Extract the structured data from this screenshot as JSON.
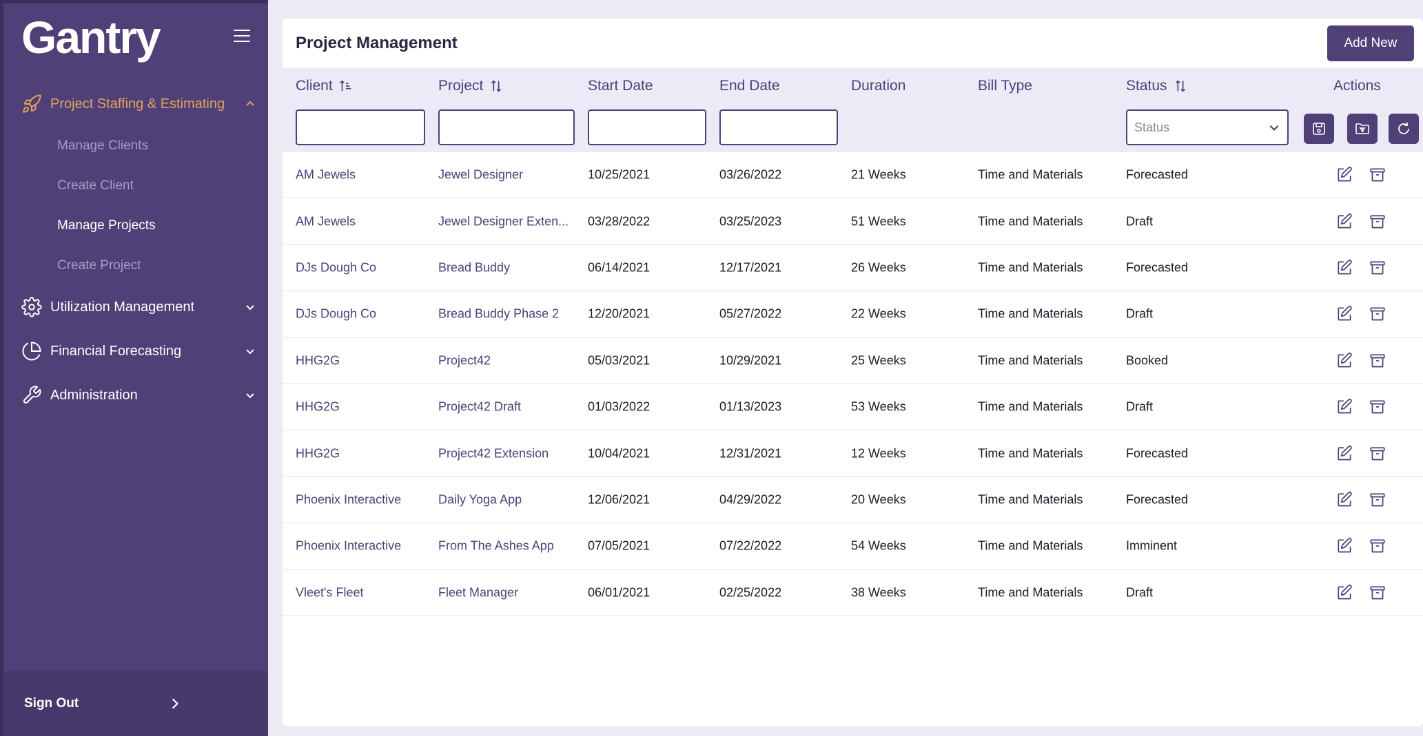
{
  "brand": {
    "logo_text": "Gantry"
  },
  "sidebar": {
    "groups": [
      {
        "label": "Project Staffing & Estimating",
        "icon": "rocket-icon",
        "expanded": true
      },
      {
        "label": "Utilization Management",
        "icon": "gear-icon",
        "expanded": false
      },
      {
        "label": "Financial Forecasting",
        "icon": "pie-chart-icon",
        "expanded": false
      },
      {
        "label": "Administration",
        "icon": "wrench-icon",
        "expanded": false
      }
    ],
    "sub_items": [
      {
        "label": "Manage Clients"
      },
      {
        "label": "Create Client"
      },
      {
        "label": "Manage Projects",
        "current": true
      },
      {
        "label": "Create Project"
      }
    ],
    "sign_out": "Sign Out"
  },
  "colors": {
    "brand": "#4f4078",
    "accent": "#e4a25c",
    "header_bg": "#ebeaf6"
  },
  "page": {
    "title": "Project Management",
    "add_button": "Add New",
    "columns": {
      "client": "Client",
      "project": "Project",
      "start_date": "Start Date",
      "end_date": "End Date",
      "duration": "Duration",
      "bill_type": "Bill Type",
      "status": "Status",
      "actions": "Actions"
    },
    "filters": {
      "client": "",
      "project": "",
      "start_date": "",
      "end_date": "",
      "status_placeholder": "Status"
    },
    "rows": [
      {
        "client": "AM Jewels",
        "project": "Jewel Designer",
        "start": "10/25/2021",
        "end": "03/26/2022",
        "duration": "21 Weeks",
        "bill": "Time and Materials",
        "status": "Forecasted"
      },
      {
        "client": "AM Jewels",
        "project": "Jewel Designer Exten...",
        "start": "03/28/2022",
        "end": "03/25/2023",
        "duration": "51 Weeks",
        "bill": "Time and Materials",
        "status": "Draft"
      },
      {
        "client": "DJs Dough Co",
        "project": "Bread Buddy",
        "start": "06/14/2021",
        "end": "12/17/2021",
        "duration": "26 Weeks",
        "bill": "Time and Materials",
        "status": "Forecasted"
      },
      {
        "client": "DJs Dough Co",
        "project": "Bread Buddy Phase 2",
        "start": "12/20/2021",
        "end": "05/27/2022",
        "duration": "22 Weeks",
        "bill": "Time and Materials",
        "status": "Draft"
      },
      {
        "client": "HHG2G",
        "project": "Project42",
        "start": "05/03/2021",
        "end": "10/29/2021",
        "duration": "25 Weeks",
        "bill": "Time and Materials",
        "status": "Booked"
      },
      {
        "client": "HHG2G",
        "project": "Project42 Draft",
        "start": "01/03/2022",
        "end": "01/13/2023",
        "duration": "53 Weeks",
        "bill": "Time and Materials",
        "status": "Draft"
      },
      {
        "client": "HHG2G",
        "project": "Project42 Extension",
        "start": "10/04/2021",
        "end": "12/31/2021",
        "duration": "12 Weeks",
        "bill": "Time and Materials",
        "status": "Forecasted"
      },
      {
        "client": "Phoenix Interactive",
        "project": "Daily Yoga App",
        "start": "12/06/2021",
        "end": "04/29/2022",
        "duration": "20 Weeks",
        "bill": "Time and Materials",
        "status": "Forecasted"
      },
      {
        "client": "Phoenix Interactive",
        "project": "From The Ashes App",
        "start": "07/05/2021",
        "end": "07/22/2022",
        "duration": "54 Weeks",
        "bill": "Time and Materials",
        "status": "Imminent"
      },
      {
        "client": "Vleet's Fleet",
        "project": "Fleet Manager",
        "start": "06/01/2021",
        "end": "02/25/2022",
        "duration": "38 Weeks",
        "bill": "Time and Materials",
        "status": "Draft"
      }
    ]
  }
}
